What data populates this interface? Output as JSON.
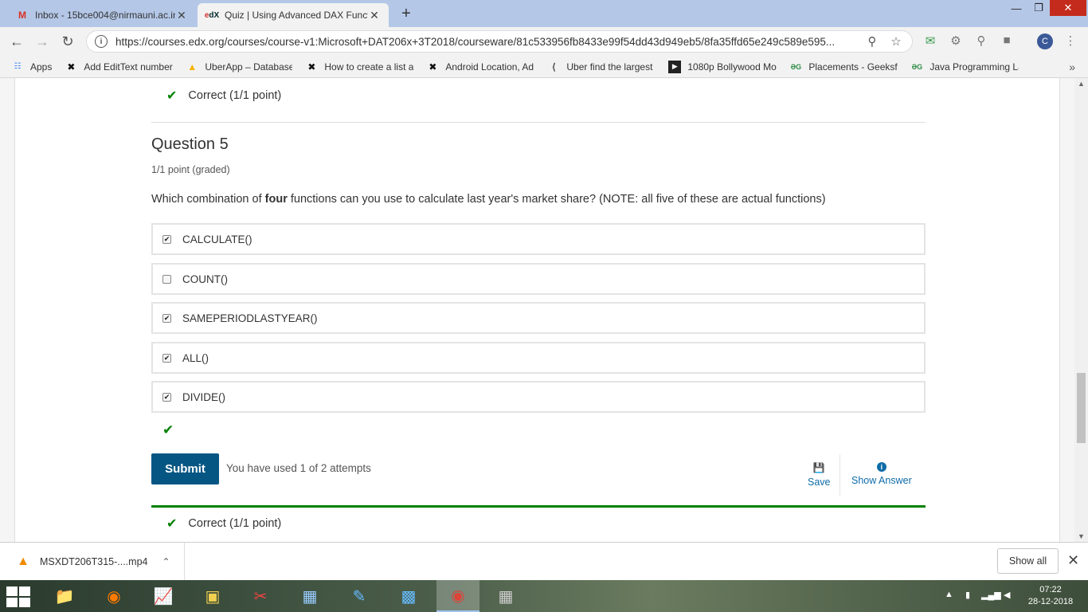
{
  "browser": {
    "tabs": [
      {
        "title": "Inbox - 15bce004@nirmauni.ac.in",
        "favicon": "gmail-icon",
        "active": false
      },
      {
        "title": "Quiz | Using Advanced DAX Functions",
        "favicon": "edx-icon",
        "active": true
      }
    ],
    "url": "https://courses.edx.org/courses/course-v1:Microsoft+DAT206x+3T2018/courseware/81c533956fb8433e99f54dd43d949eb5/8fa35ffd65e249c589e595...",
    "bookmarks": [
      "Apps",
      "Add EditText number",
      "UberApp – Database",
      "How to create a list a",
      "Android Location, Ad",
      "Uber find the largest",
      "1080p Bollywood Mo",
      "Placements - Geeksfo",
      "Java Programming La"
    ],
    "profile_initial": "C"
  },
  "page": {
    "previous_result": "Correct (1/1 point)",
    "question": {
      "title": "Question 5",
      "points": "1/1 point (graded)",
      "prompt_before": "Which combination of ",
      "prompt_bold": "four",
      "prompt_after": " functions can you use to calculate last year's market share? (NOTE: all five of these are actual functions)",
      "options": [
        {
          "label": "CALCULATE()",
          "checked": true
        },
        {
          "label": "COUNT()",
          "checked": false
        },
        {
          "label": "SAMEPERIODLASTYEAR()",
          "checked": true
        },
        {
          "label": "ALL()",
          "checked": true
        },
        {
          "label": "DIVIDE()",
          "checked": true
        }
      ]
    },
    "submit_label": "Submit",
    "attempts_text": "You have used 1 of 2 attempts",
    "save_label": "Save",
    "show_answer_label": "Show Answer",
    "result": "Correct (1/1 point)",
    "accent_color": "#008100",
    "submit_color": "#065683"
  },
  "downloads": {
    "file_name": "MSXDT206T315-....mp4",
    "show_all_label": "Show all"
  },
  "taskbar": {
    "time": "07:22",
    "date": "28-12-2018"
  }
}
